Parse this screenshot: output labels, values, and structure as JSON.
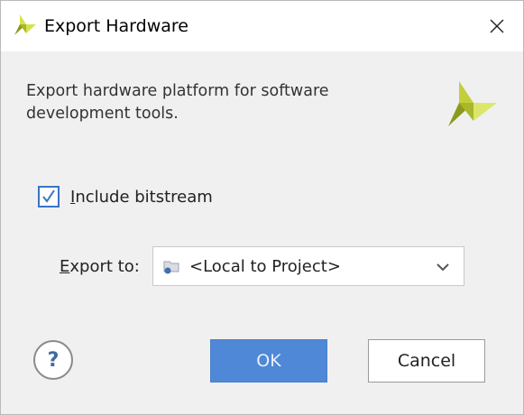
{
  "dialog": {
    "title": "Export Hardware",
    "close_icon": "close-icon",
    "logo_icon": "xilinx-logo-icon",
    "description": "Export hardware platform for software development tools."
  },
  "include_bitstream": {
    "label_mnemonic": "I",
    "label_rest": "nclude bitstream",
    "checked": true
  },
  "export_to": {
    "label_mnemonic": "E",
    "label_rest": "xport to:",
    "selected_value": "<Local to Project>",
    "icon": "folder-icon",
    "dropdown_icon": "chevron-down-icon"
  },
  "buttons": {
    "help_glyph": "?",
    "ok_label": "OK",
    "cancel_label": "Cancel"
  },
  "colors": {
    "accent": "#4f88d6",
    "logo_dark": "#8a9a1e",
    "logo_light": "#d6e24b"
  }
}
